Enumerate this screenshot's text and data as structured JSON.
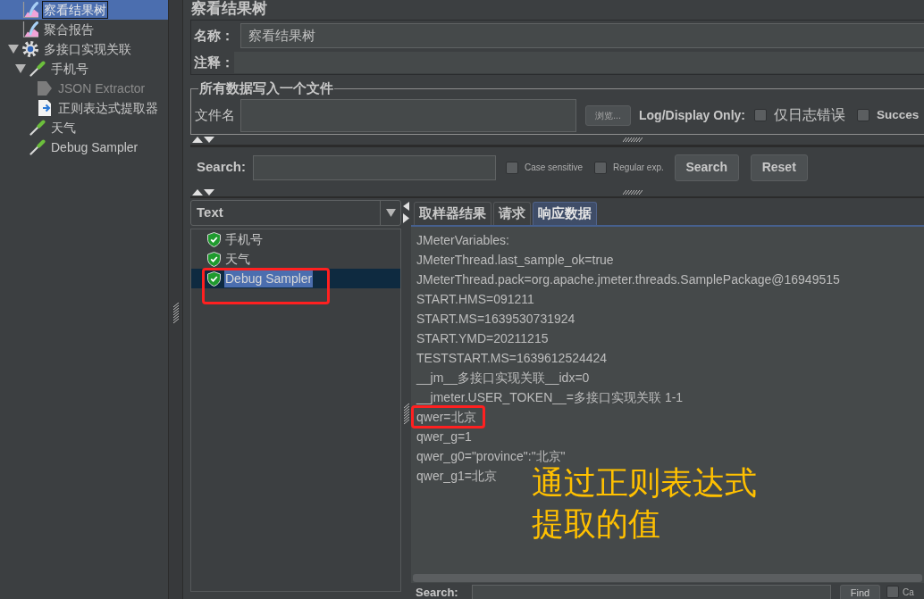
{
  "sidebar": {
    "tree": [
      {
        "label": "察看结果树",
        "kind": "listener",
        "selected": true,
        "disabled": false
      },
      {
        "label": "聚合报告",
        "kind": "listener",
        "selected": false,
        "disabled": false
      },
      {
        "label": "多接口实现关联",
        "kind": "thread_group",
        "selected": false,
        "disabled": false,
        "expanded": true,
        "children": [
          {
            "label": "手机号",
            "kind": "sampler",
            "selected": false,
            "disabled": false,
            "expanded": true,
            "children": [
              {
                "label": "JSON Extractor",
                "kind": "json_extractor",
                "selected": false,
                "disabled": true
              },
              {
                "label": "正则表达式提取器",
                "kind": "regex_extractor",
                "selected": false,
                "disabled": false
              }
            ]
          },
          {
            "label": "天气",
            "kind": "sampler",
            "selected": false,
            "disabled": false
          },
          {
            "label": "Debug Sampler",
            "kind": "sampler",
            "selected": false,
            "disabled": false
          }
        ]
      }
    ]
  },
  "panel": {
    "title": "察看结果树",
    "name": {
      "label": "名称：",
      "value": "察看结果树"
    },
    "comment": {
      "label": "注释："
    },
    "file_output": {
      "legend": "所有数据写入一个文件",
      "filename_label": "文件名",
      "browse_button": "浏览...",
      "filter_label": "Log/Display Only:",
      "filters": [
        {
          "label": "仅日志错误",
          "checked": false
        },
        {
          "label": "Succes",
          "checked": false
        }
      ]
    },
    "search": {
      "label": "Search:",
      "options": [
        {
          "label": "Case sensitive",
          "checked": false
        },
        {
          "label": "Regular exp.",
          "checked": false
        }
      ],
      "buttons": [
        "Search",
        "Reset"
      ]
    },
    "results": {
      "renderer": "Text",
      "samples": [
        {
          "label": "手机号",
          "passed": true,
          "selected": false,
          "annotated": false
        },
        {
          "label": "天气",
          "passed": true,
          "selected": false,
          "annotated": false
        },
        {
          "label": "Debug Sampler",
          "passed": true,
          "selected": true,
          "annotated": true
        }
      ],
      "tabs": [
        {
          "label": "取样器结果",
          "selected": false
        },
        {
          "label": "请求",
          "selected": false
        },
        {
          "label": "响应数据",
          "selected": true
        }
      ],
      "response": {
        "lines": [
          {
            "text": "JMeterVariables:",
            "annotated": false
          },
          {
            "text": "JMeterThread.last_sample_ok=true",
            "annotated": false
          },
          {
            "text": "JMeterThread.pack=org.apache.jmeter.threads.SamplePackage@16949515",
            "annotated": false
          },
          {
            "text": "START.HMS=091211",
            "annotated": false
          },
          {
            "text": "START.MS=1639530731924",
            "annotated": false
          },
          {
            "text": "START.YMD=20211215",
            "annotated": false
          },
          {
            "text": "TESTSTART.MS=1639612524424",
            "annotated": false
          },
          {
            "text": "__jm__多接口实现关联__idx=0",
            "annotated": false
          },
          {
            "text": "__jmeter.USER_TOKEN__=多接口实现关联 1-1",
            "annotated": false
          },
          {
            "text": "qwer=北京",
            "annotated": true
          },
          {
            "text": "qwer_g=1",
            "annotated": false
          },
          {
            "text": "qwer_g0=\"province\":\"北京\"",
            "annotated": false
          },
          {
            "text": "qwer_g1=北京",
            "annotated": false
          }
        ],
        "annotation": "通过正则表达式提取的值"
      },
      "find": {
        "label": "Search:",
        "button": "Find",
        "options": [
          {
            "label": "Ca",
            "checked": false
          }
        ]
      }
    }
  }
}
